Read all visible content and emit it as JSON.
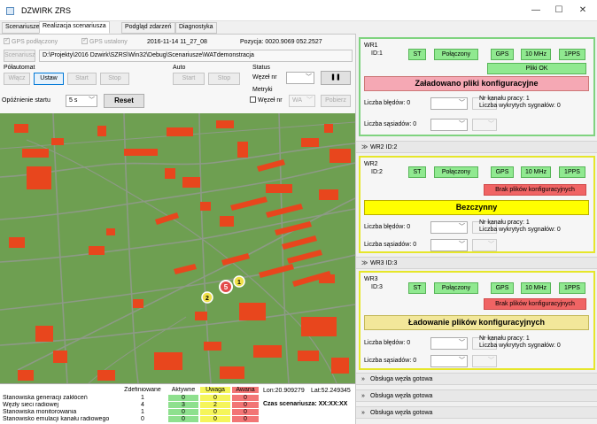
{
  "window": {
    "title": "DZWIRK ZRS",
    "min": "—",
    "max": "☐",
    "close": "✕"
  },
  "tabs": [
    "Scenariusze",
    "Realizacja scenariusza",
    "Podgląd zdarzeń",
    "Diagnostyka"
  ],
  "status": {
    "gps_connected": "GPS podłączony",
    "gps_set": "GPS ustalony",
    "datetime": "2016-11-14 11_27_08",
    "position": "Pozycja: 0020.9069 052.2527"
  },
  "scenario": {
    "button": "Scenariusz",
    "path": "D:\\Projekty\\2016 Dzwirk\\SZRS\\Win32\\Debug\\Scenariusze\\WATdemonstracja"
  },
  "semiauto": {
    "label": "Półautomat",
    "on": "Włącz",
    "set": "Ustaw",
    "start": "Start",
    "stop": "Stop"
  },
  "auto": {
    "label": "Auto",
    "start": "Start",
    "stop": "Stop"
  },
  "status_group": {
    "label": "Status",
    "node_label": "Węzeł nr",
    "pause": "❚❚"
  },
  "metrics": {
    "label": "Metryki",
    "node_label": "Węzeł nr",
    "combo": "WA",
    "fetch": "Pobierz"
  },
  "delay": {
    "label": "Opóźnienie startu",
    "value": "5 s",
    "reset": "Reset"
  },
  "map_markers": {
    "red": "5",
    "yellow1": "1",
    "yellow2": "2"
  },
  "table": {
    "headers": [
      "Zdefiniowane",
      "Aktywne",
      "Uwaga",
      "Awaria"
    ],
    "rows": [
      {
        "label": "Stanowiska generacji zakłóceń",
        "values": [
          "1",
          "0",
          "0",
          "0"
        ]
      },
      {
        "label": "Węzły sieci radiowej",
        "values": [
          "4",
          "3",
          "2",
          "0"
        ]
      },
      {
        "label": "Stanowiska monitorowania",
        "values": [
          "1",
          "0",
          "0",
          "0"
        ]
      },
      {
        "label": "Stanowisko emulacji kanału radiowego",
        "values": [
          "0",
          "0",
          "0",
          "0"
        ]
      }
    ],
    "lon": "Lon:20.909279",
    "lat": "Lat:52.249345",
    "scenario_time": "Czas scenariusza: XX:XX:XX"
  },
  "nodes": [
    {
      "name": "WR1",
      "id": "ID:1",
      "buttons": [
        "ST",
        "Połączony",
        "GPS",
        "10 MHz",
        "1PPS"
      ],
      "file_status": "Pliki OK",
      "banner": "Załadowano pliki konfiguracyjne",
      "errors": "Liczba błędów: 0",
      "neighbors": "Liczba sąsiadów: 0",
      "channel": "Nr kanału pracy: 1",
      "signals": "Liczba wykrytych sygnałów: 0"
    },
    {
      "section": "WR2 ID:2",
      "name": "WR2",
      "id": "ID:2",
      "buttons": [
        "ST",
        "Połączony",
        "GPS",
        "10 MHz",
        "1PPS"
      ],
      "file_status": "Brak plików konfiguracyjnych",
      "banner": "Bezczynny",
      "errors": "Liczba błędów: 0",
      "neighbors": "Liczba sąsiadów: 0",
      "channel": "Nr kanału pracy: 1",
      "signals": "Liczba wykrytych sygnałów: 0"
    },
    {
      "section": "WR3 ID:3",
      "name": "WR3",
      "id": "ID:3",
      "buttons": [
        "ST",
        "Połączony",
        "GPS",
        "10 MHz",
        "1PPS"
      ],
      "file_status": "Brak plików konfiguracyjnych",
      "banner": "Ładowanie plików konfiguracyjnych",
      "errors": "Liczba błędów: 0",
      "neighbors": "Liczba sąsiadów: 0",
      "channel": "Nr kanału pracy: 1",
      "signals": "Liczba wykrytych sygnałów: 0"
    }
  ],
  "footer_sections": [
    "Obsługa węzła gotowa",
    "Obsługa węzła gotowa",
    "Obsługa węzła gotowa"
  ],
  "colors": {
    "map_bg": "#6e9f51",
    "building": "#e8461d",
    "road": "#8d9a86",
    "ok_green": "#90e990",
    "warn_red": "#f06464"
  }
}
